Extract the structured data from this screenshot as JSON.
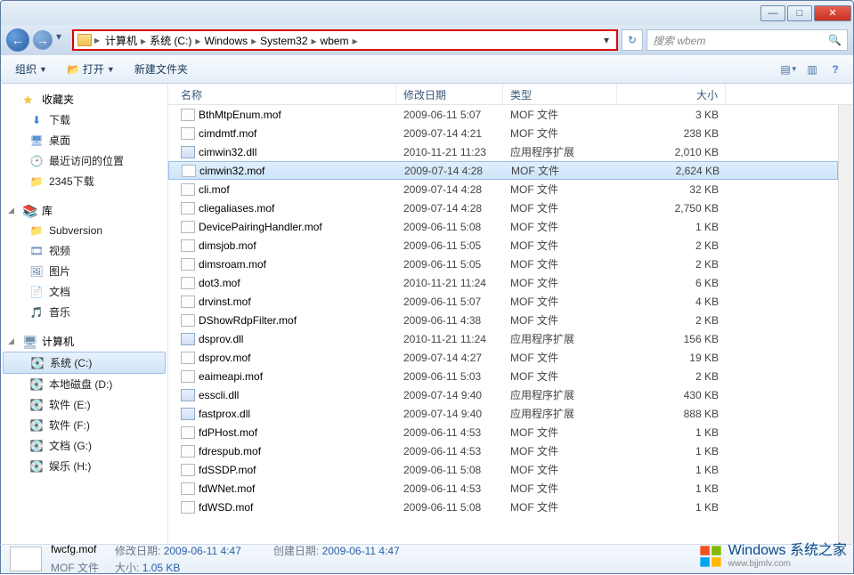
{
  "titlebar": {
    "minimize": "—",
    "maximize": "□",
    "close": "✕"
  },
  "nav": {
    "back": "←",
    "forward": "→",
    "dropdown": "▾",
    "refresh": "↻"
  },
  "breadcrumb": {
    "items": [
      "计算机",
      "系统 (C:)",
      "Windows",
      "System32",
      "wbem"
    ],
    "sep": "▸",
    "dropdown": "▾"
  },
  "search": {
    "placeholder": "搜索 wbem",
    "icon": "🔍"
  },
  "toolbar": {
    "organize": "组织",
    "open": "打开",
    "newfolder": "新建文件夹",
    "view_icon": "▤",
    "preview_icon": "▥",
    "help_icon": "?"
  },
  "sidebar": {
    "favorites": {
      "label": "收藏夹",
      "items": [
        {
          "icon": "⬇",
          "label": "下载",
          "color": "#3a80d8"
        },
        {
          "icon": "🖥",
          "label": "桌面",
          "color": "#5a90d0"
        },
        {
          "icon": "🕑",
          "label": "最近访问的位置",
          "color": "#8a7a50"
        },
        {
          "icon": "📁",
          "label": "2345下载",
          "color": "#f0c050"
        }
      ]
    },
    "libraries": {
      "label": "库",
      "items": [
        {
          "icon": "📁",
          "label": "Subversion"
        },
        {
          "icon": "🎞",
          "label": "视频"
        },
        {
          "icon": "🖼",
          "label": "图片"
        },
        {
          "icon": "📄",
          "label": "文档"
        },
        {
          "icon": "🎵",
          "label": "音乐"
        }
      ]
    },
    "computer": {
      "label": "计算机",
      "items": [
        {
          "icon": "💽",
          "label": "系统 (C:)",
          "selected": true
        },
        {
          "icon": "💽",
          "label": "本地磁盘 (D:)"
        },
        {
          "icon": "💽",
          "label": "软件 (E:)"
        },
        {
          "icon": "💽",
          "label": "软件 (F:)"
        },
        {
          "icon": "💽",
          "label": "文档 (G:)"
        },
        {
          "icon": "💽",
          "label": "娱乐 (H:)"
        }
      ]
    }
  },
  "columns": {
    "name": "名称",
    "date": "修改日期",
    "type": "类型",
    "size": "大小"
  },
  "files": [
    {
      "name": "BthMtpEnum.mof",
      "date": "2009-06-11 5:07",
      "type": "MOF 文件",
      "size": "3 KB",
      "kind": "mof"
    },
    {
      "name": "cimdmtf.mof",
      "date": "2009-07-14 4:21",
      "type": "MOF 文件",
      "size": "238 KB",
      "kind": "mof"
    },
    {
      "name": "cimwin32.dll",
      "date": "2010-11-21 11:23",
      "type": "应用程序扩展",
      "size": "2,010 KB",
      "kind": "dll"
    },
    {
      "name": "cimwin32.mof",
      "date": "2009-07-14 4:28",
      "type": "MOF 文件",
      "size": "2,624 KB",
      "kind": "mof",
      "selected": true
    },
    {
      "name": "cli.mof",
      "date": "2009-07-14 4:28",
      "type": "MOF 文件",
      "size": "32 KB",
      "kind": "mof"
    },
    {
      "name": "cliegaliases.mof",
      "date": "2009-07-14 4:28",
      "type": "MOF 文件",
      "size": "2,750 KB",
      "kind": "mof"
    },
    {
      "name": "DevicePairingHandler.mof",
      "date": "2009-06-11 5:08",
      "type": "MOF 文件",
      "size": "1 KB",
      "kind": "mof"
    },
    {
      "name": "dimsjob.mof",
      "date": "2009-06-11 5:05",
      "type": "MOF 文件",
      "size": "2 KB",
      "kind": "mof"
    },
    {
      "name": "dimsroam.mof",
      "date": "2009-06-11 5:05",
      "type": "MOF 文件",
      "size": "2 KB",
      "kind": "mof"
    },
    {
      "name": "dot3.mof",
      "date": "2010-11-21 11:24",
      "type": "MOF 文件",
      "size": "6 KB",
      "kind": "mof"
    },
    {
      "name": "drvinst.mof",
      "date": "2009-06-11 5:07",
      "type": "MOF 文件",
      "size": "4 KB",
      "kind": "mof"
    },
    {
      "name": "DShowRdpFilter.mof",
      "date": "2009-06-11 4:38",
      "type": "MOF 文件",
      "size": "2 KB",
      "kind": "mof"
    },
    {
      "name": "dsprov.dll",
      "date": "2010-11-21 11:24",
      "type": "应用程序扩展",
      "size": "156 KB",
      "kind": "dll"
    },
    {
      "name": "dsprov.mof",
      "date": "2009-07-14 4:27",
      "type": "MOF 文件",
      "size": "19 KB",
      "kind": "mof"
    },
    {
      "name": "eaimeapi.mof",
      "date": "2009-06-11 5:03",
      "type": "MOF 文件",
      "size": "2 KB",
      "kind": "mof"
    },
    {
      "name": "esscli.dll",
      "date": "2009-07-14 9:40",
      "type": "应用程序扩展",
      "size": "430 KB",
      "kind": "dll"
    },
    {
      "name": "fastprox.dll",
      "date": "2009-07-14 9:40",
      "type": "应用程序扩展",
      "size": "888 KB",
      "kind": "dll"
    },
    {
      "name": "fdPHost.mof",
      "date": "2009-06-11 4:53",
      "type": "MOF 文件",
      "size": "1 KB",
      "kind": "mof"
    },
    {
      "name": "fdrespub.mof",
      "date": "2009-06-11 4:53",
      "type": "MOF 文件",
      "size": "1 KB",
      "kind": "mof"
    },
    {
      "name": "fdSSDP.mof",
      "date": "2009-06-11 5:08",
      "type": "MOF 文件",
      "size": "1 KB",
      "kind": "mof"
    },
    {
      "name": "fdWNet.mof",
      "date": "2009-06-11 4:53",
      "type": "MOF 文件",
      "size": "1 KB",
      "kind": "mof"
    },
    {
      "name": "fdWSD.mof",
      "date": "2009-06-11 5:08",
      "type": "MOF 文件",
      "size": "1 KB",
      "kind": "mof"
    }
  ],
  "details": {
    "name": "fwcfg.mof",
    "type": "MOF 文件",
    "mod_label": "修改日期:",
    "mod": "2009-06-11 4:47",
    "size_label": "大小:",
    "size": "1.05 KB",
    "created_label": "创建日期:",
    "created": "2009-06-11 4:47"
  },
  "watermark": {
    "title": "Windows 系统之家",
    "url": "www.bjjmlv.com"
  }
}
